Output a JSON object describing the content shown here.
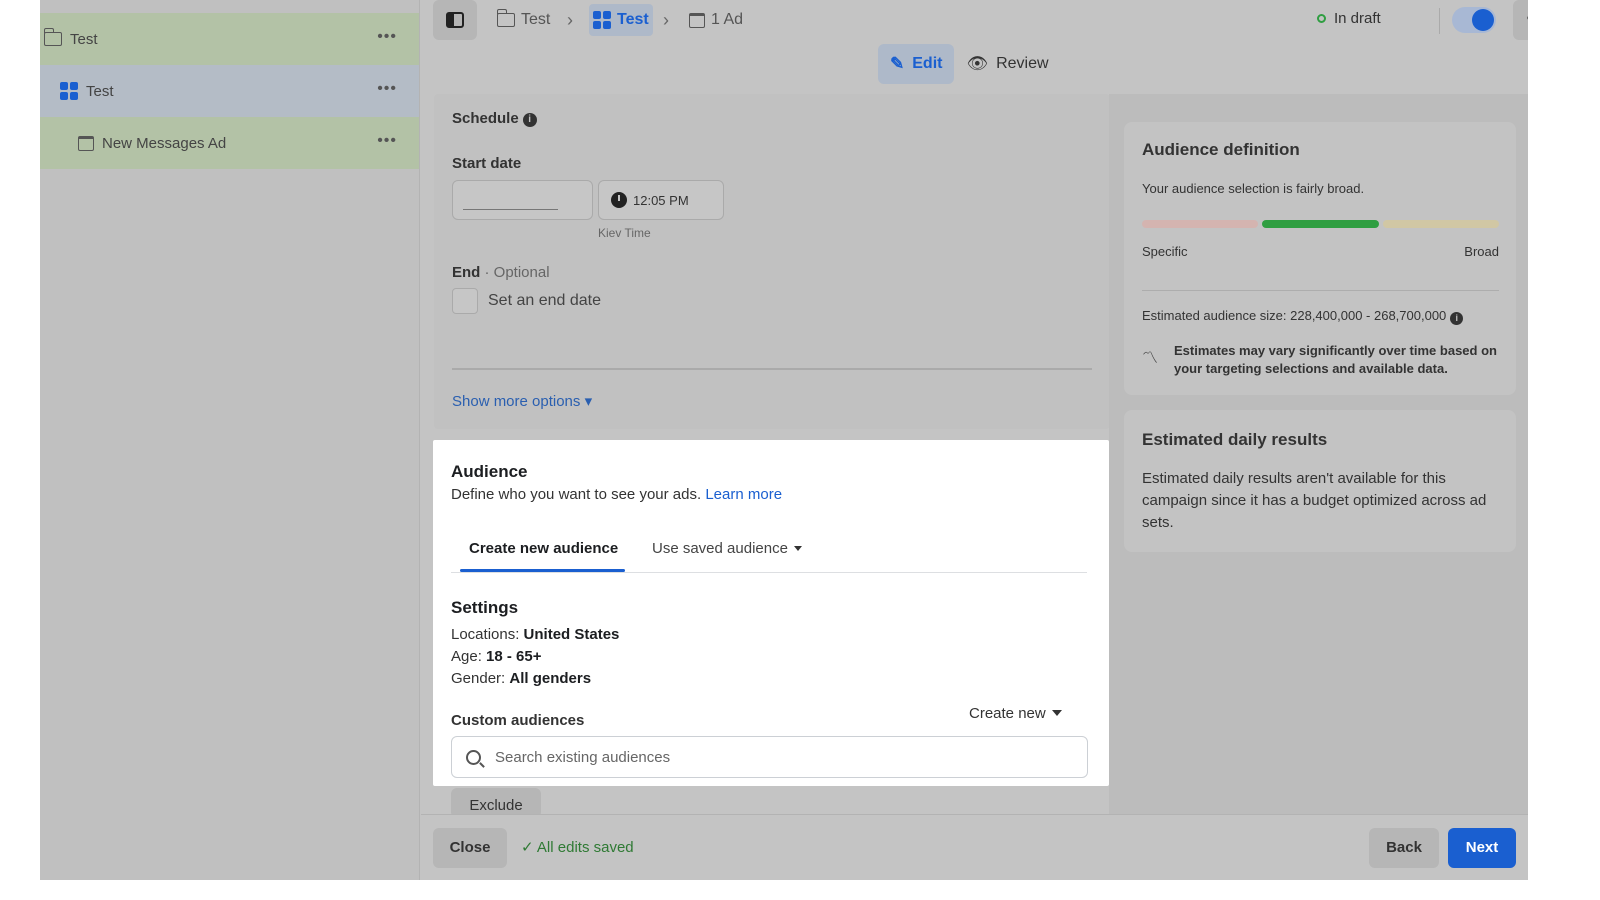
{
  "sidebar": {
    "campaign": {
      "label": "Test"
    },
    "adset": {
      "label": "Test"
    },
    "ad": {
      "label": "New Messages Ad"
    },
    "more_glyph": "•••"
  },
  "topbar": {
    "breadcrumb": [
      {
        "label": "Test"
      },
      {
        "label": "Test"
      },
      {
        "label": "1 Ad"
      }
    ],
    "status": "In draft",
    "toggle_on": true,
    "more_glyph": "•••"
  },
  "modes": {
    "edit": "Edit",
    "review": "Review"
  },
  "schedule": {
    "title": "Schedule",
    "start_label": "Start date",
    "start_date_value": "",
    "time_value": "12:05 PM",
    "timezone": "Kiev Time",
    "end_label": "End",
    "end_optional": " · Optional",
    "end_checkbox_label": "Set an end date",
    "show_more": "Show more options ▾"
  },
  "audience": {
    "title": "Audience",
    "subtitle": "Define who you want to see your ads.",
    "learn_more": "Learn more",
    "tabs": {
      "create": "Create new audience",
      "saved": "Use saved audience"
    },
    "settings": {
      "title": "Settings",
      "locations_key": "Locations: ",
      "locations_value": "United States",
      "age_key": "Age: ",
      "age_value": "18 - 65+",
      "gender_key": "Gender: ",
      "gender_value": "All genders"
    },
    "custom_label": "Custom audiences",
    "create_new": "Create new",
    "search_placeholder": "Search existing audiences",
    "exclude": "Exclude"
  },
  "definition": {
    "title": "Audience definition",
    "summary": "Your audience selection is fairly broad.",
    "specific": "Specific",
    "broad": "Broad",
    "meter_level": "middle (2 of 3)",
    "size_text": "Estimated audience size: 228,400,000 - 268,700,000",
    "note": "Estimates may vary significantly over time based on your targeting selections and available data."
  },
  "results": {
    "title": "Estimated daily results",
    "text": "Estimated daily results aren't available for this campaign since it has a budget optimized across ad sets."
  },
  "footer": {
    "close": "Close",
    "saved": "All edits saved",
    "back": "Back",
    "next": "Next"
  },
  "colors": {
    "accent": "#1a5fd0",
    "success": "#2f9e41"
  }
}
